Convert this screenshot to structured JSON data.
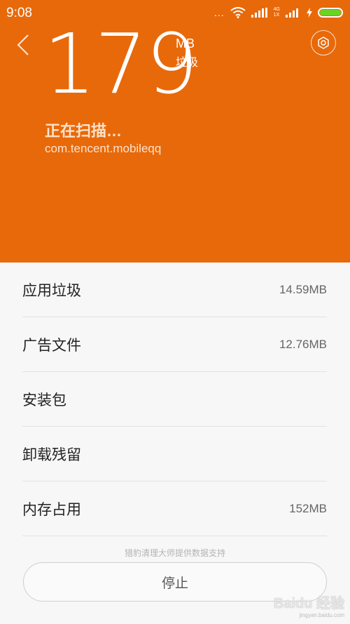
{
  "status_bar": {
    "time": "9:08",
    "dots": "...",
    "net_top": "4G",
    "net_bottom": "1X",
    "battery_color": "#6cd322"
  },
  "header": {
    "back_icon": "chevron-left-icon",
    "settings_icon": "gear-icon",
    "size_value": "179",
    "size_unit": "MB",
    "size_label": "垃圾",
    "scan_title": "正在扫描…",
    "scan_package": "com.tencent.mobileqq",
    "accent_color": "#e8690a"
  },
  "categories": [
    {
      "label": "应用垃圾",
      "value": "14.59MB"
    },
    {
      "label": "广告文件",
      "value": "12.76MB"
    },
    {
      "label": "安装包",
      "value": ""
    },
    {
      "label": "卸载残留",
      "value": ""
    },
    {
      "label": "内存占用",
      "value": "152MB"
    }
  ],
  "footer": {
    "note": "猎豹清理大师提供数据支持",
    "stop_label": "停止"
  },
  "watermark": {
    "main": "Baidu 经验",
    "sub": "jingyan.baidu.com"
  }
}
